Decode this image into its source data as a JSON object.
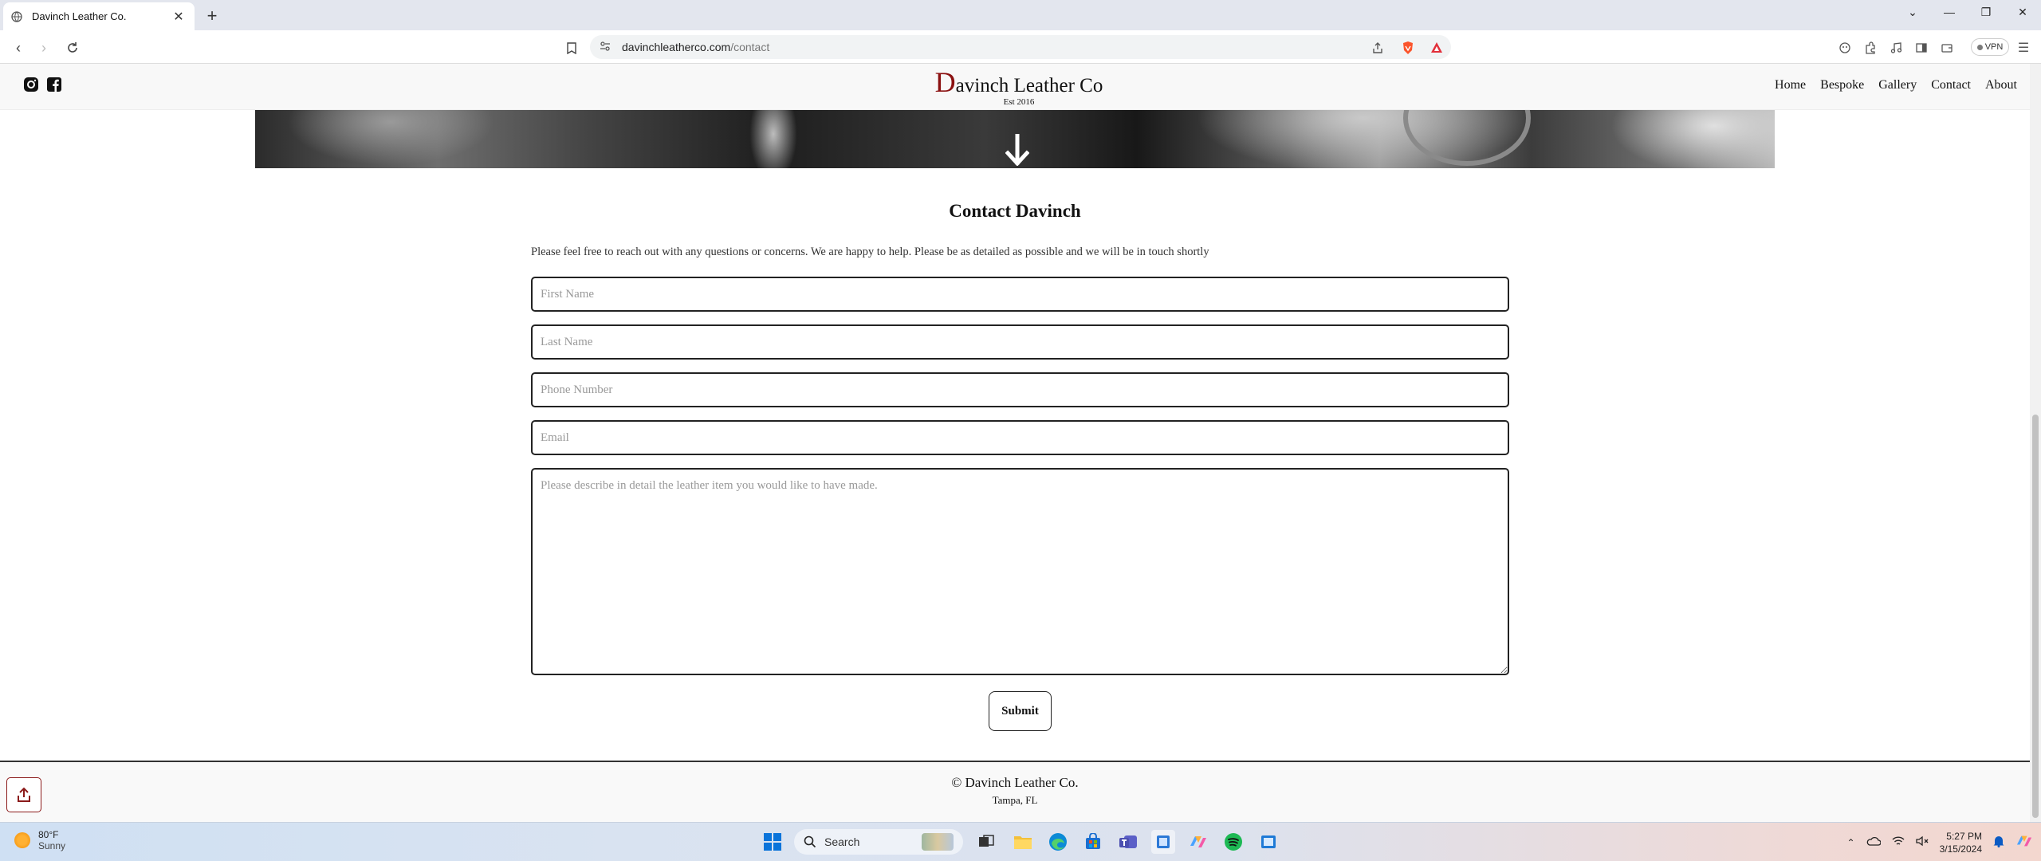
{
  "browser": {
    "tab_title": "Davinch Leather Co.",
    "url_host": "davinchleatherco.com",
    "url_path": "/contact",
    "vpn_label": "VPN"
  },
  "site": {
    "logo_initial": "D",
    "logo_rest": "avinch Leather Co",
    "logo_tagline": "Est 2016",
    "nav": [
      "Home",
      "Bespoke",
      "Gallery",
      "Contact",
      "About"
    ],
    "accent_color": "#8b1111"
  },
  "contact": {
    "title": "Contact Davinch",
    "intro": "Please feel free to reach out with any questions or concerns. We are happy to help. Please be as detailed as possible and we will be in touch shortly",
    "placeholders": {
      "first_name": "First Name",
      "last_name": "Last Name",
      "phone": "Phone Number",
      "email": "Email",
      "description": "Please describe in detail the leather item you would like to have made."
    },
    "submit_label": "Submit"
  },
  "footer": {
    "copyright": "© Davinch Leather Co.",
    "location": "Tampa, FL"
  },
  "taskbar": {
    "weather_temp": "80°F",
    "weather_cond": "Sunny",
    "search_label": "Search",
    "time": "5:27 PM",
    "date": "3/15/2024"
  }
}
